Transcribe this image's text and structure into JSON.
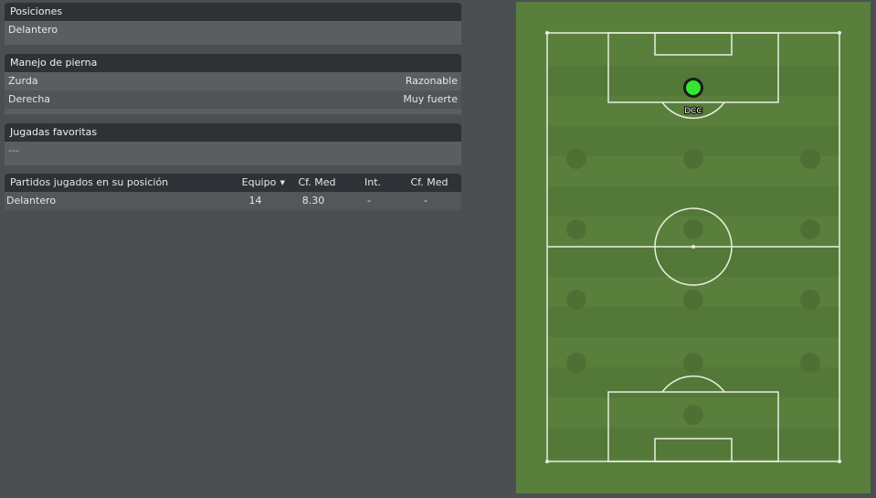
{
  "positions": {
    "title": "Posiciones",
    "value": "Delantero"
  },
  "footedness": {
    "title": "Manejo de pierna",
    "rows": [
      {
        "label": "Zurda",
        "value": "Razonable"
      },
      {
        "label": "Derecha",
        "value": "Muy fuerte"
      }
    ]
  },
  "favorite_moves": {
    "title": "Jugadas favoritas",
    "value": "---"
  },
  "matches": {
    "columns": [
      "Partidos jugados en su posición",
      "Equipo",
      "Cf. Med",
      "Int.",
      "Cf. Med"
    ],
    "sort_indicator": "▼",
    "rows": [
      {
        "position": "Delantero",
        "team": "14",
        "avg_rating": "8.30",
        "intl": "-",
        "intl_avg_rating": "-"
      }
    ]
  },
  "pitch": {
    "marker_label": "DCC",
    "marker_color": "#33e633",
    "grass_light": "#5a7f3c",
    "grass_dark": "#547837"
  }
}
